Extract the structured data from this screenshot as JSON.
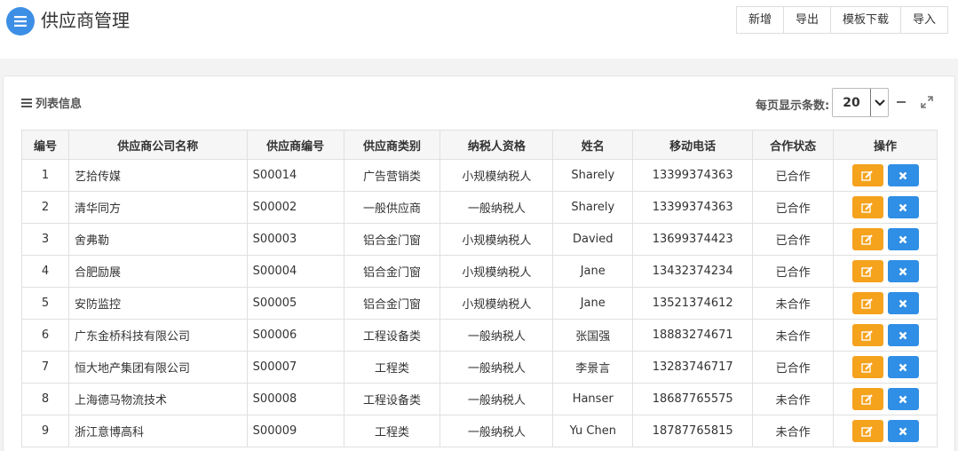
{
  "header": {
    "title": "供应商管理",
    "buttons": [
      "新增",
      "导出",
      "模板下载",
      "导入"
    ]
  },
  "panel": {
    "title": "列表信息",
    "page_size_label": "每页显示条数:",
    "page_size": "20"
  },
  "table": {
    "columns": [
      "编号",
      "供应商公司名称",
      "供应商编号",
      "供应商类别",
      "纳税人资格",
      "姓名",
      "移动电话",
      "合作状态",
      "操作"
    ],
    "rows": [
      [
        "1",
        "艺拾传媒",
        "S00014",
        "广告营销类",
        "小规模纳税人",
        "Sharely",
        "13399374363",
        "已合作"
      ],
      [
        "2",
        "清华同方",
        "S00002",
        "一般供应商",
        "一般纳税人",
        "Sharely",
        "13399374363",
        "已合作"
      ],
      [
        "3",
        "舍弗勒",
        "S00003",
        "铝合金门窗",
        "小规模纳税人",
        "Davied",
        "13699374423",
        "已合作"
      ],
      [
        "4",
        "合肥励展",
        "S00004",
        "铝合金门窗",
        "小规模纳税人",
        "Jane",
        "13432374234",
        "已合作"
      ],
      [
        "5",
        "安防监控",
        "S00005",
        "铝合金门窗",
        "小规模纳税人",
        "Jane",
        "13521374612",
        "未合作"
      ],
      [
        "6",
        "广东金桥科技有限公司",
        "S00006",
        "工程设备类",
        "一般纳税人",
        "张国强",
        "18883274671",
        "未合作"
      ],
      [
        "7",
        "恒大地产集团有限公司",
        "S00007",
        "工程类",
        "一般纳税人",
        "李景言",
        "13283746717",
        "已合作"
      ],
      [
        "8",
        "上海德马物流技术",
        "S00008",
        "工程设备类",
        "一般纳税人",
        "Hanser",
        "18687765575",
        "未合作"
      ],
      [
        "9",
        "浙江意博高科",
        "S00009",
        "工程类",
        "一般纳税人",
        "Yu Chen",
        "18787765815",
        "未合作"
      ]
    ]
  },
  "colors": {
    "accent_blue": "#2f8ee5",
    "edit_orange": "#f5a21c"
  },
  "icons": {
    "menu": "menu-icon",
    "edit": "edit-icon",
    "delete": "close-icon",
    "minus": "minus-icon",
    "expand": "expand-icon"
  }
}
